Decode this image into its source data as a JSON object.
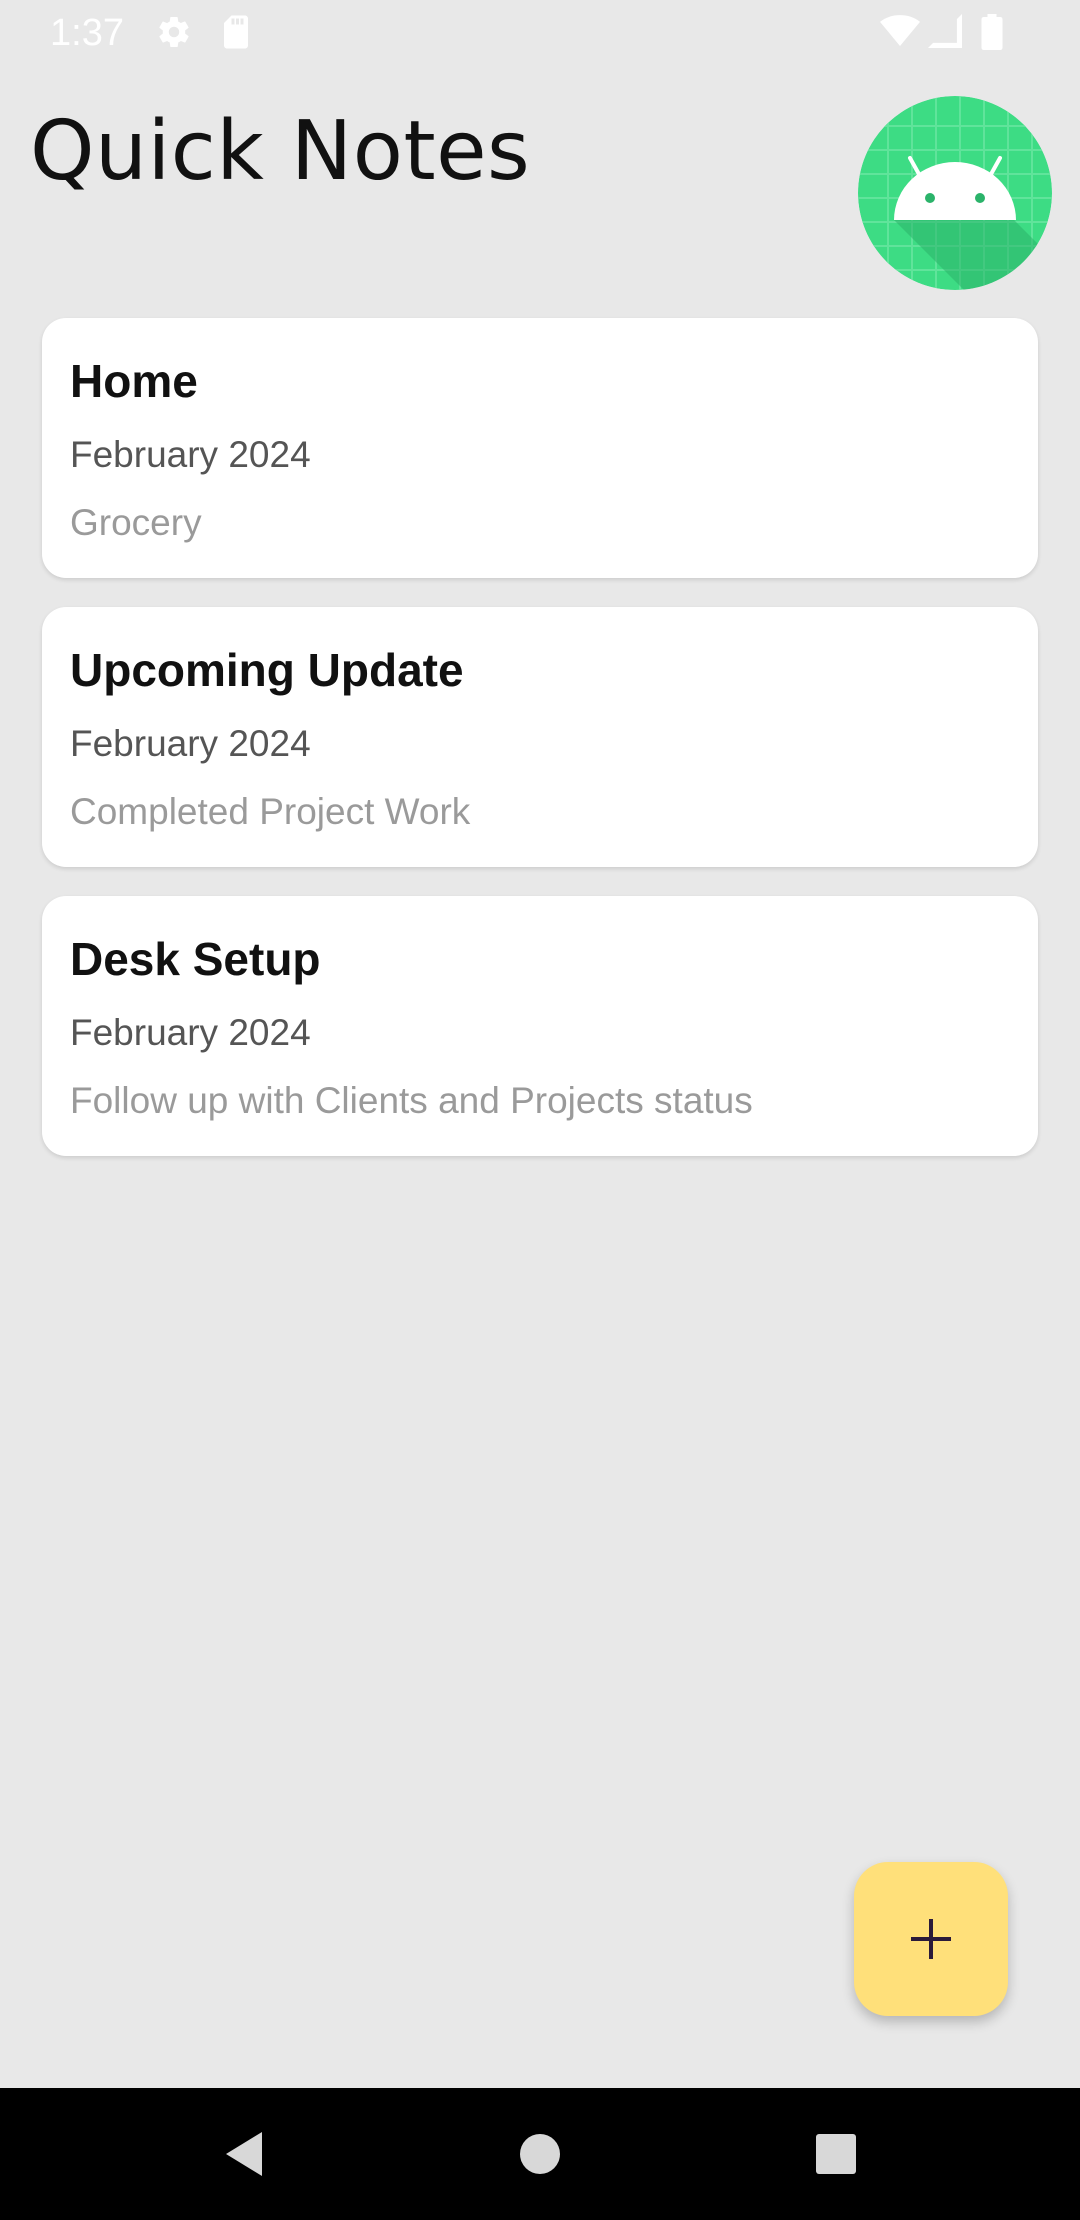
{
  "status_bar": {
    "time": "1:37",
    "icons": [
      "settings-icon",
      "sd-card-icon",
      "wifi-icon",
      "signal-icon",
      "battery-icon"
    ]
  },
  "header": {
    "title": "Quick Notes",
    "avatar_icon": "android-icon"
  },
  "notes": [
    {
      "title": "Home",
      "date": "February 2024",
      "preview": "Grocery"
    },
    {
      "title": "Upcoming Update",
      "date": "February 2024",
      "preview": "Completed Project Work"
    },
    {
      "title": "Desk Setup",
      "date": "February 2024",
      "preview": "Follow up with Clients and Projects status"
    }
  ],
  "fab": {
    "icon": "plus-icon",
    "color": "#ffe07a"
  },
  "nav_bar": {
    "icons": [
      "back-icon",
      "home-icon",
      "recents-icon"
    ]
  },
  "colors": {
    "background": "#e8e8e8",
    "card": "#ffffff",
    "avatar": "#3ddc84"
  }
}
